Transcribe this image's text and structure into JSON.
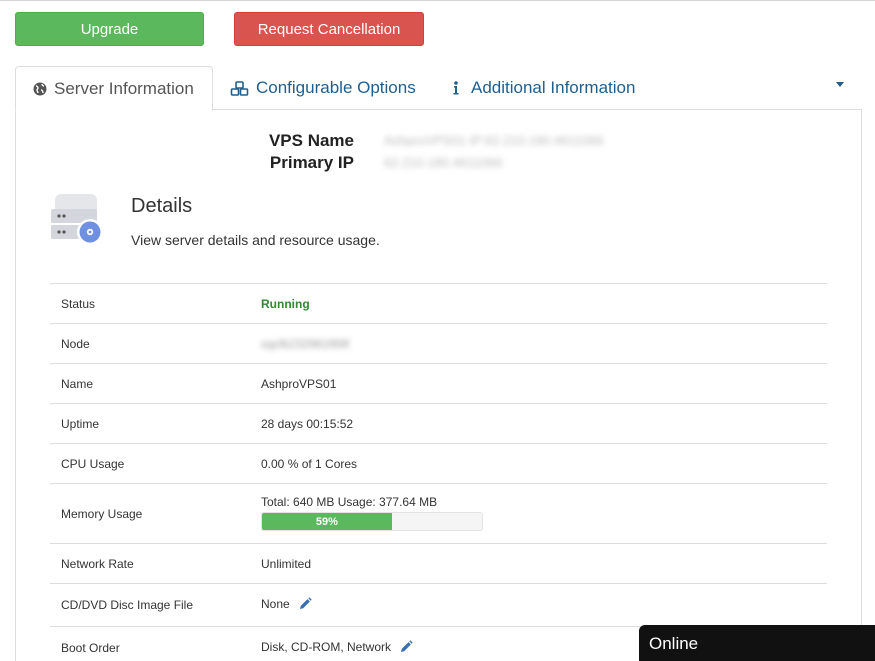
{
  "actions": {
    "upgrade_label": "Upgrade",
    "cancel_label": "Request Cancellation"
  },
  "tabs": {
    "server_information": "Server Information",
    "configurable_options": "Configurable Options",
    "additional_information": "Additional Information"
  },
  "vps": {
    "name_label": "VPS Name",
    "name_value": "AshproVPS01 IP:62.210.180.4611066",
    "ip_label": "Primary IP",
    "ip_value": "62.210.180.4611066"
  },
  "details": {
    "title": "Details",
    "subtitle": "View server details and resource usage."
  },
  "table": {
    "status": {
      "label": "Status",
      "value": "Running"
    },
    "node": {
      "label": "Node",
      "value": "sqcfk232961f69f"
    },
    "name": {
      "label": "Name",
      "value": "AshproVPS01"
    },
    "uptime": {
      "label": "Uptime",
      "value": "28 days 00:15:52"
    },
    "cpu": {
      "label": "CPU Usage",
      "value": "0.00 % of 1 Cores"
    },
    "memory": {
      "label": "Memory Usage",
      "value": "Total: 640 MB Usage: 377.64 MB",
      "percent_label": "59%",
      "percent": 59
    },
    "network": {
      "label": "Network Rate",
      "value": "Unlimited"
    },
    "iso": {
      "label": "CD/DVD Disc Image File",
      "value": "None"
    },
    "boot": {
      "label": "Boot Order",
      "value": "Disk, CD-ROM, Network"
    }
  },
  "chat": {
    "status_label": "Online"
  },
  "colors": {
    "success": "#5cb85c",
    "danger": "#d9534f",
    "link": "#1f5f8f",
    "running": "#2e8b2e"
  },
  "icons": [
    "globe-icon",
    "cubes-icon",
    "info-icon",
    "caret-down-icon",
    "server-icon",
    "pencil-icon"
  ]
}
